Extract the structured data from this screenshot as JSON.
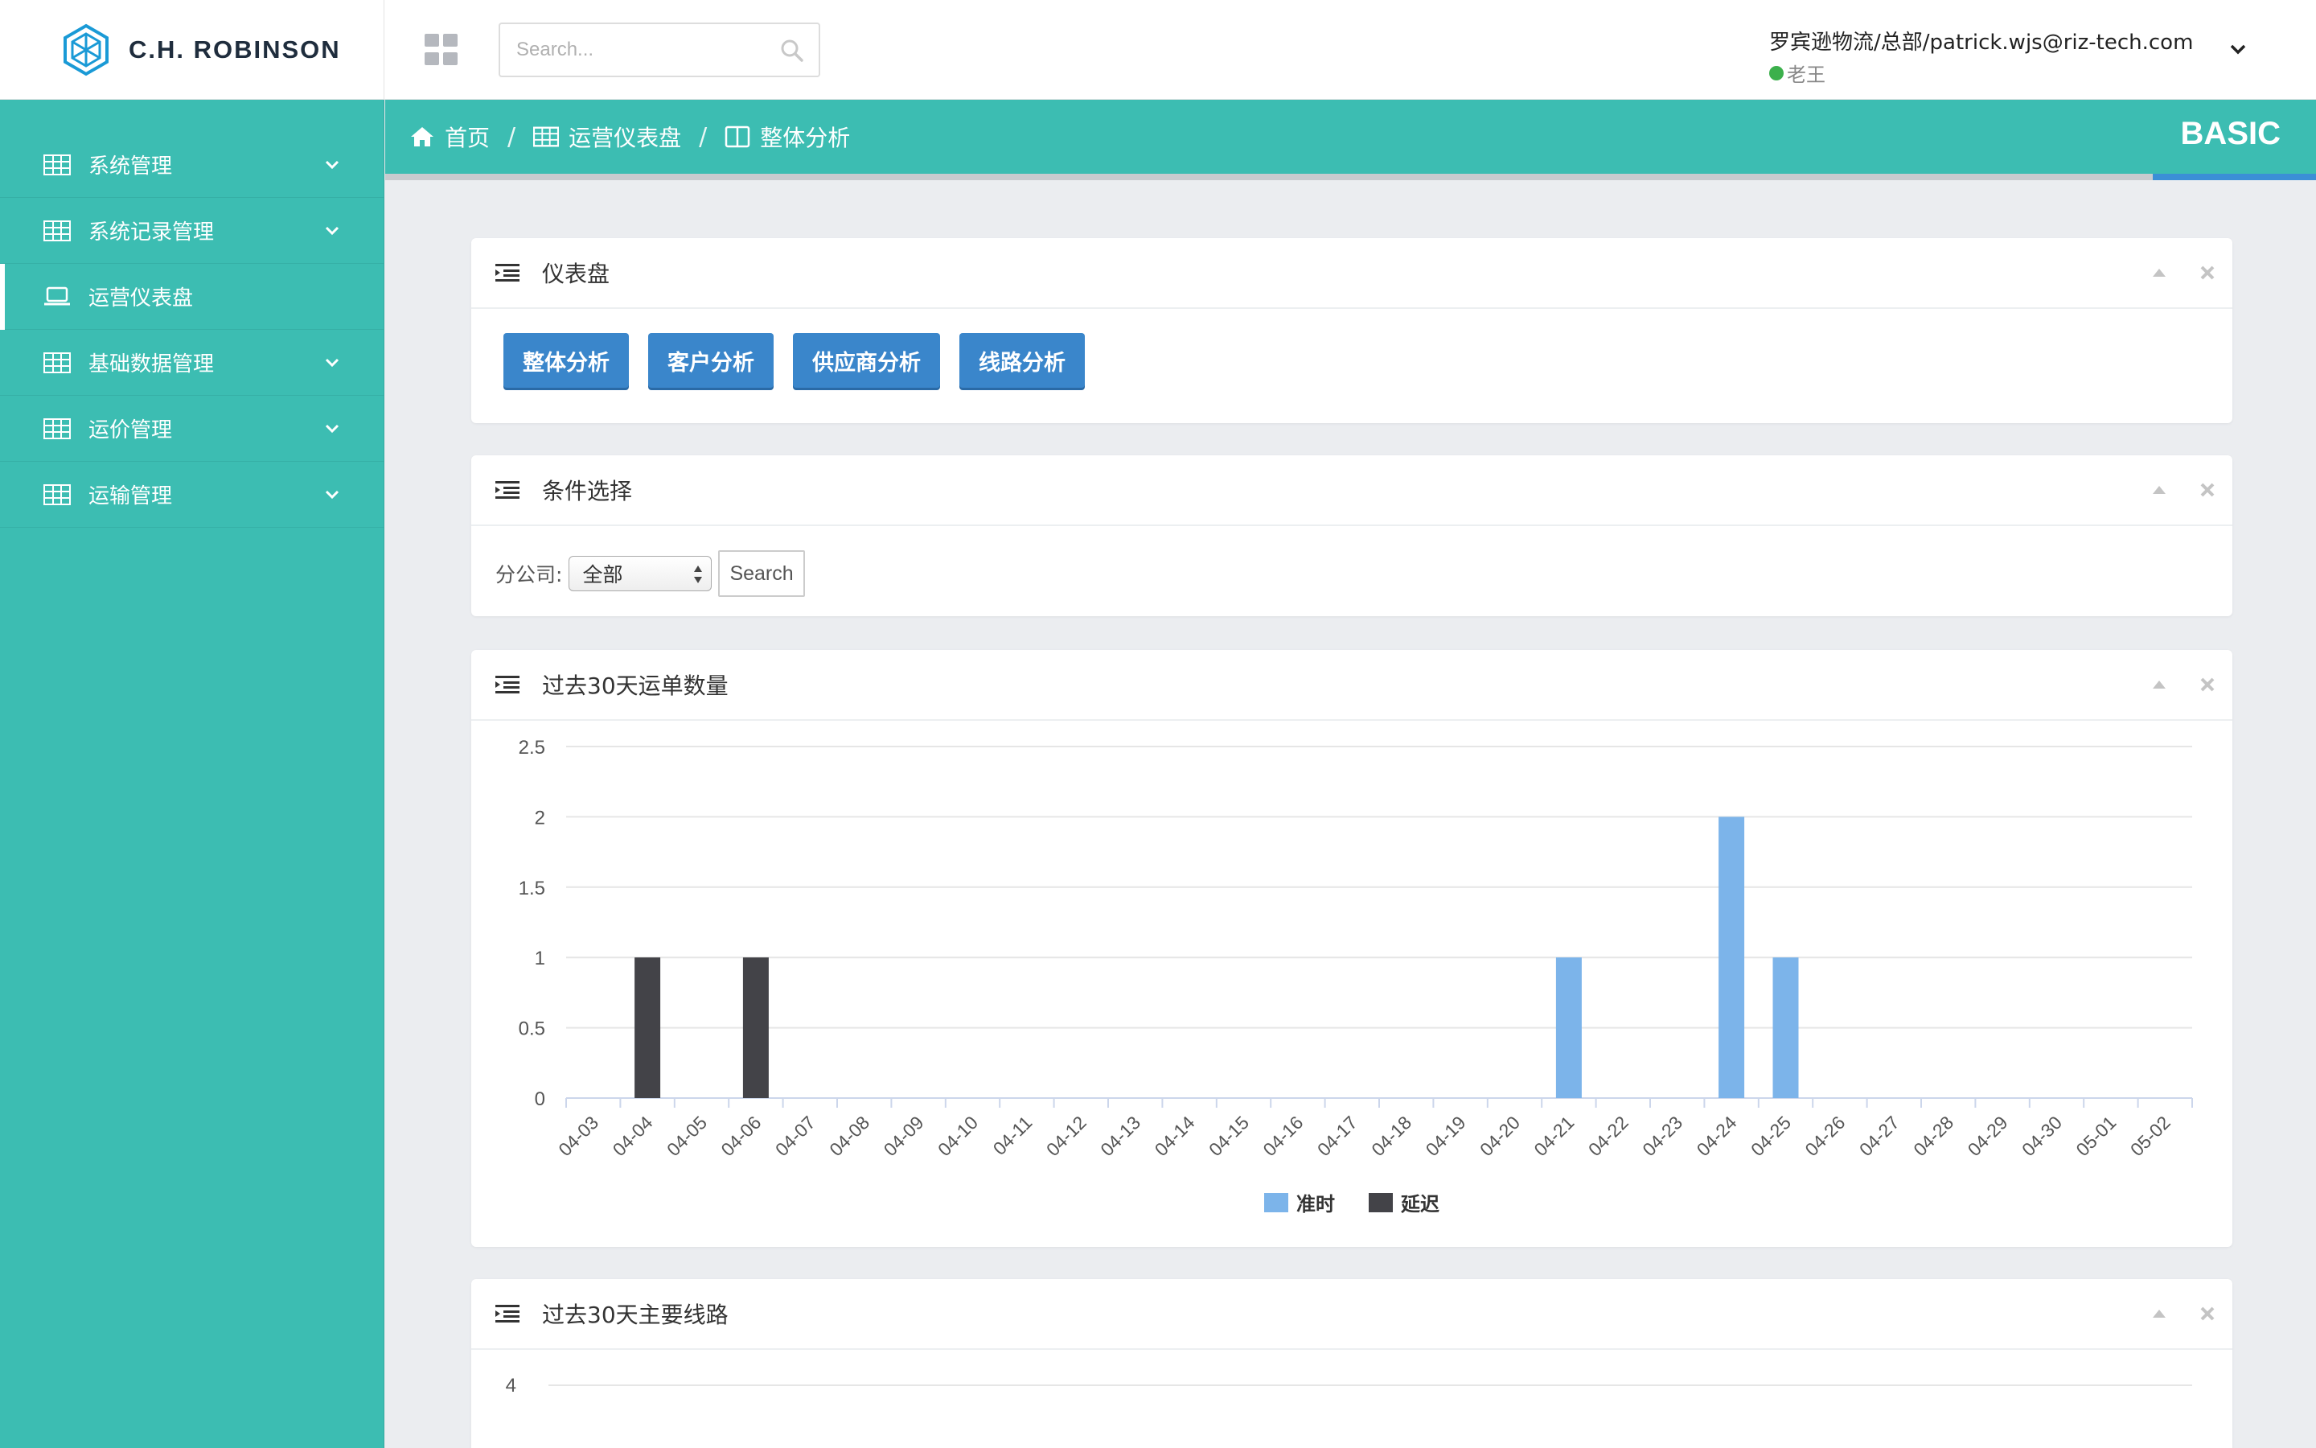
{
  "brand": {
    "name": "C.H. ROBINSON"
  },
  "header": {
    "search_placeholder": "Search...",
    "user_name": "罗宾逊物流/总部/patrick.wjs@riz-tech.com",
    "user_status": "老王"
  },
  "sidebar": {
    "items": [
      {
        "label": "系统管理",
        "icon": "table-icon",
        "has_children": true
      },
      {
        "label": "系统记录管理",
        "icon": "table-icon",
        "has_children": true
      },
      {
        "label": "运营仪表盘",
        "icon": "laptop-icon",
        "has_children": false,
        "active": true
      },
      {
        "label": "基础数据管理",
        "icon": "table-icon",
        "has_children": true
      },
      {
        "label": "运价管理",
        "icon": "table-icon",
        "has_children": true
      },
      {
        "label": "运输管理",
        "icon": "table-icon",
        "has_children": true
      }
    ]
  },
  "breadcrumb": {
    "items": [
      {
        "label": "首页",
        "icon": "home-icon"
      },
      {
        "label": "运营仪表盘",
        "icon": "table-icon"
      },
      {
        "label": "整体分析",
        "icon": "columns-icon"
      }
    ],
    "separator": "/",
    "badge": "BASIC"
  },
  "panels": {
    "dashboard": {
      "title": "仪表盘",
      "buttons": [
        "整体分析",
        "客户分析",
        "供应商分析",
        "线路分析"
      ]
    },
    "filter": {
      "title": "条件选择",
      "branch_label": "分公司:",
      "branch_value": "全部",
      "search_label": "Search"
    },
    "orders": {
      "title": "过去30天运单数量"
    },
    "routes": {
      "title": "过去30天主要线路"
    }
  },
  "colors": {
    "sidebar": "#3cbdb2",
    "button": "#3a86cb",
    "series_ontime": "#7cb4ea",
    "series_late": "#434348"
  },
  "chart_data": [
    {
      "type": "bar",
      "categories": [
        "04-03",
        "04-04",
        "04-05",
        "04-06",
        "04-07",
        "04-08",
        "04-09",
        "04-10",
        "04-11",
        "04-12",
        "04-13",
        "04-14",
        "04-15",
        "04-16",
        "04-17",
        "04-18",
        "04-19",
        "04-20",
        "04-21",
        "04-22",
        "04-23",
        "04-24",
        "04-25",
        "04-26",
        "04-27",
        "04-28",
        "04-29",
        "04-30",
        "05-01",
        "05-02"
      ],
      "series": [
        {
          "name": "准时",
          "color": "#7cb4ea",
          "values": [
            0,
            0,
            0,
            0,
            0,
            0,
            0,
            0,
            0,
            0,
            0,
            0,
            0,
            0,
            0,
            0,
            0,
            0,
            1,
            0,
            0,
            2,
            1,
            0,
            0,
            0,
            0,
            0,
            0,
            0
          ]
        },
        {
          "name": "延迟",
          "color": "#434348",
          "values": [
            0,
            1,
            0,
            1,
            0,
            0,
            0,
            0,
            0,
            0,
            0,
            0,
            0,
            0,
            0,
            0,
            0,
            0,
            0,
            0,
            0,
            0,
            0,
            0,
            0,
            0,
            0,
            0,
            0,
            0
          ]
        }
      ],
      "yticks": [
        "0",
        "0.5",
        "1",
        "1.5",
        "2",
        "2.5"
      ],
      "ylim": [
        0,
        2.5
      ],
      "grid": true,
      "legend": "bottom-center"
    },
    {
      "type": "bar",
      "yticks": [
        "4"
      ],
      "grid": true
    }
  ]
}
